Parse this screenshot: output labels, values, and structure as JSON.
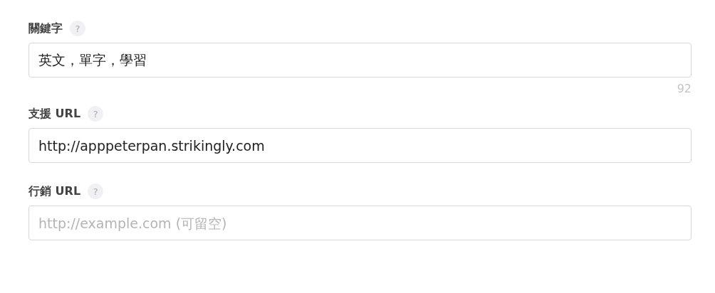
{
  "fields": [
    {
      "label": "關鍵字",
      "help": "?",
      "value": "英文，單字，學習",
      "counter": "92"
    },
    {
      "label": "支援 URL",
      "help": "?",
      "value": "http://apppeterpan.strikingly.com"
    },
    {
      "label": "行銷 URL",
      "help": "?",
      "placeholder": "http://example.com (可留空)"
    }
  ]
}
